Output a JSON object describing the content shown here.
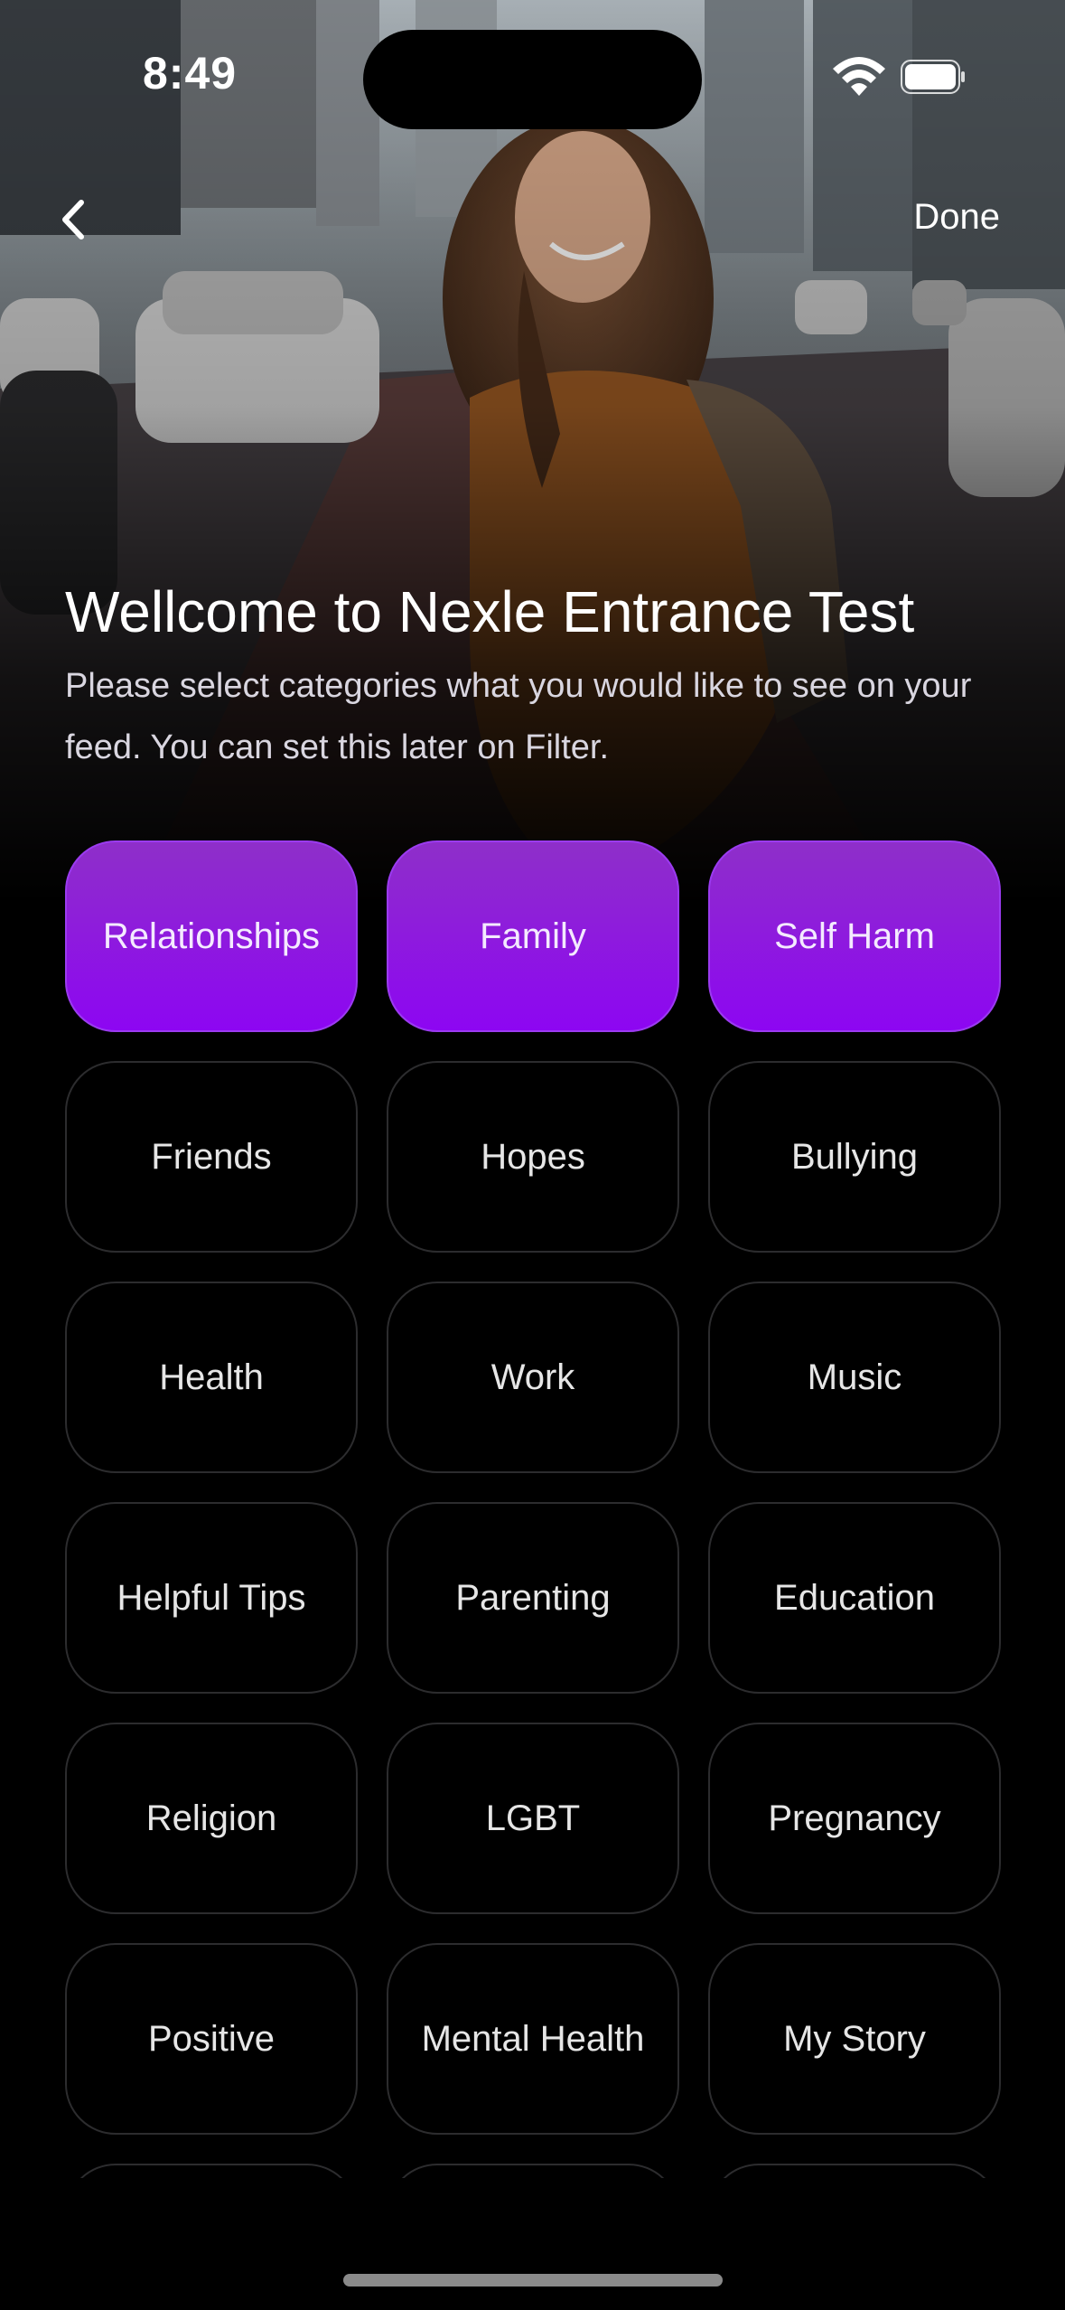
{
  "status_bar": {
    "time": "8:49"
  },
  "nav": {
    "done_label": "Done"
  },
  "header": {
    "title": "Wellcome to Nexle Entrance Test",
    "subtitle": "Please select categories what you would like to see on your feed. You can set this later on Filter."
  },
  "categories": [
    {
      "label": "Relationships",
      "selected": true
    },
    {
      "label": "Family",
      "selected": true
    },
    {
      "label": "Self Harm",
      "selected": true
    },
    {
      "label": "Friends",
      "selected": false
    },
    {
      "label": "Hopes",
      "selected": false
    },
    {
      "label": "Bullying",
      "selected": false
    },
    {
      "label": "Health",
      "selected": false
    },
    {
      "label": "Work",
      "selected": false
    },
    {
      "label": "Music",
      "selected": false
    },
    {
      "label": "Helpful Tips",
      "selected": false
    },
    {
      "label": "Parenting",
      "selected": false
    },
    {
      "label": "Education",
      "selected": false
    },
    {
      "label": "Religion",
      "selected": false
    },
    {
      "label": "LGBT",
      "selected": false
    },
    {
      "label": "Pregnancy",
      "selected": false
    },
    {
      "label": "Positive",
      "selected": false
    },
    {
      "label": "Mental Health",
      "selected": false
    },
    {
      "label": "My Story",
      "selected": false
    },
    {
      "label": "",
      "selected": false
    },
    {
      "label": "",
      "selected": false
    },
    {
      "label": "",
      "selected": false
    }
  ],
  "colors": {
    "background": "#000000",
    "selected_top": "#8e2fc9",
    "selected_bottom": "#8d06f2",
    "chip_border": "#2c2c2e"
  }
}
